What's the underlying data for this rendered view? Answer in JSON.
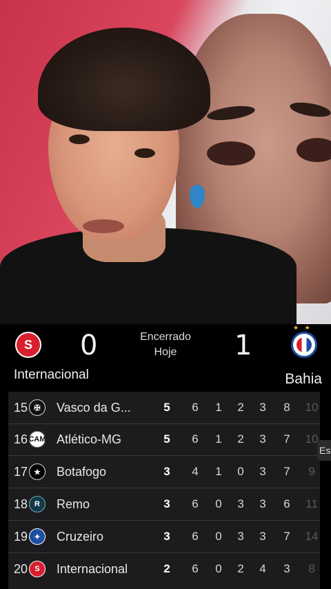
{
  "match": {
    "home_team": "Internacional",
    "away_team": "Bahia",
    "home_score": "0",
    "away_score": "1",
    "status_line1": "Encerrado",
    "status_line2": "Hoje",
    "away_stars": "★ ★"
  },
  "standings": {
    "rows": [
      {
        "pos": "15",
        "team": "Vasco da G...",
        "crest": "vasco-crest",
        "pts": "5",
        "pj": "6",
        "v": "1",
        "e": "2",
        "d": "3",
        "gp": "8",
        "gc": "10"
      },
      {
        "pos": "16",
        "team": "Atlético-MG",
        "crest": "atletico-mg-crest",
        "pts": "5",
        "pj": "6",
        "v": "1",
        "e": "2",
        "d": "3",
        "gp": "7",
        "gc": "10"
      },
      {
        "pos": "17",
        "team": "Botafogo",
        "crest": "botafogo-crest",
        "pts": "3",
        "pj": "4",
        "v": "1",
        "e": "0",
        "d": "3",
        "gp": "7",
        "gc": "9"
      },
      {
        "pos": "18",
        "team": "Remo",
        "crest": "remo-crest",
        "pts": "3",
        "pj": "6",
        "v": "0",
        "e": "3",
        "d": "3",
        "gp": "6",
        "gc": "11"
      },
      {
        "pos": "19",
        "team": "Cruzeiro",
        "crest": "cruzeiro-crest",
        "pts": "3",
        "pj": "6",
        "v": "0",
        "e": "3",
        "d": "3",
        "gp": "7",
        "gc": "14"
      },
      {
        "pos": "20",
        "team": "Internacional",
        "crest": "internacional-crest",
        "pts": "2",
        "pj": "6",
        "v": "0",
        "e": "2",
        "d": "4",
        "gp": "3",
        "gc": "8"
      }
    ]
  },
  "side_tab": "Est",
  "colors": {
    "inter_red": "#d81f2e",
    "bahia_blue": "#1d4fa0",
    "table_bg": "#1c1c1e"
  }
}
